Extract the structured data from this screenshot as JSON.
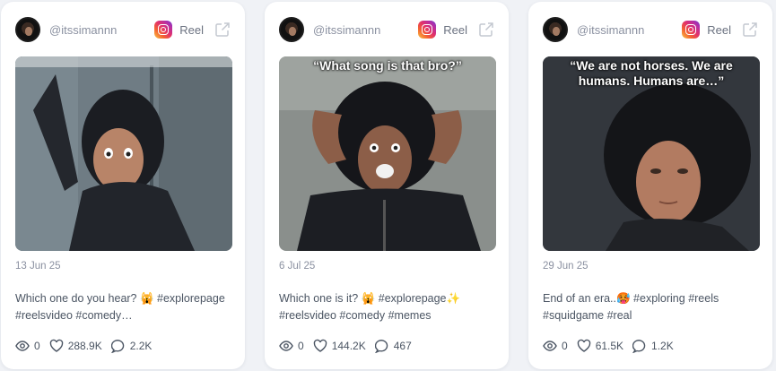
{
  "colors": {
    "background": "#f0f2f6",
    "card": "#ffffff",
    "muted_text": "#8a90a0",
    "body_text": "#4b5563"
  },
  "cards": [
    {
      "username": "@itssimannn",
      "platform_label": "Reel",
      "overlay_text": "",
      "date": "13 Jun 25",
      "description": "Which one do you hear? 🙀 #explorepage #reelsvideo #comedy…",
      "views": "0",
      "likes": "288.9K",
      "comments": "2.2K"
    },
    {
      "username": "@itssimannn",
      "platform_label": "Reel",
      "overlay_text": "“What song is that bro?”",
      "date": "6 Jul 25",
      "description": "Which one is it? 🙀 #explorepage✨ #reelsvideo #comedy #memes",
      "views": "0",
      "likes": "144.2K",
      "comments": "467"
    },
    {
      "username": "@itssimannn",
      "platform_label": "Reel",
      "overlay_text": "“We are not horses. We are humans. Humans are…”",
      "date": "29 Jun 25",
      "description": "End of an era..🥵 #exploring #reels #squidgame #real",
      "views": "0",
      "likes": "61.5K",
      "comments": "1.2K"
    }
  ]
}
